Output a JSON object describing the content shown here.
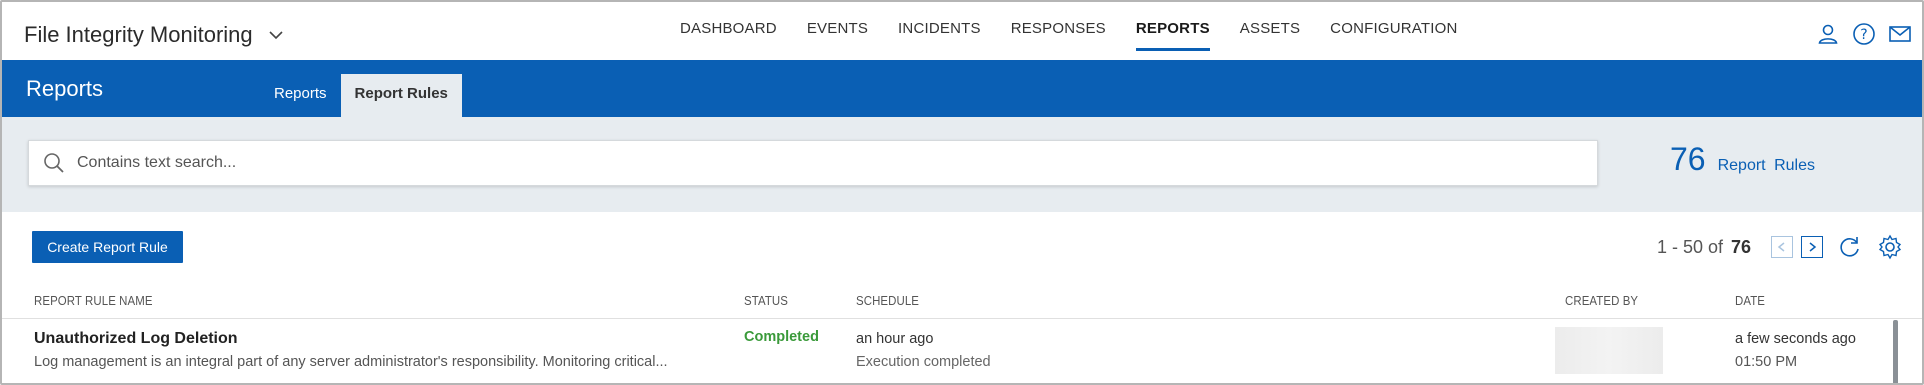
{
  "app": {
    "title": "File Integrity Monitoring"
  },
  "nav": {
    "items": [
      {
        "label": "DASHBOARD"
      },
      {
        "label": "EVENTS"
      },
      {
        "label": "INCIDENTS"
      },
      {
        "label": "RESPONSES"
      },
      {
        "label": "REPORTS",
        "active": true
      },
      {
        "label": "ASSETS"
      },
      {
        "label": "CONFIGURATION"
      }
    ]
  },
  "header": {
    "title": "Reports",
    "tabs": [
      {
        "label": "Reports"
      },
      {
        "label": "Report Rules",
        "active": true
      }
    ]
  },
  "search": {
    "placeholder": "Contains text search...",
    "value": ""
  },
  "summary": {
    "count": "76",
    "label": "Report Rules"
  },
  "toolbar": {
    "create_label": "Create Report Rule"
  },
  "pager": {
    "range": "1 - 50 of",
    "total": "76"
  },
  "table": {
    "columns": [
      "REPORT RULE NAME",
      "STATUS",
      "SCHEDULE",
      "CREATED BY",
      "DATE"
    ],
    "rows": [
      {
        "name": "Unauthorized Log Deletion",
        "description": "Log management is an integral part of any server administrator's responsibility. Monitoring critical...",
        "status": "Completed",
        "schedule": "an hour ago",
        "schedule_detail": "Execution completed",
        "date": "a few seconds ago",
        "time": "01:50 PM"
      }
    ]
  },
  "colors": {
    "brand": "#0a5fb4",
    "band": "#e7ecf0",
    "success": "#3a9a3a"
  },
  "icons": [
    "chevron-down-icon",
    "user-icon",
    "help-icon",
    "mail-icon",
    "search-icon",
    "chevron-left-icon",
    "chevron-right-icon",
    "refresh-icon",
    "gear-icon"
  ]
}
